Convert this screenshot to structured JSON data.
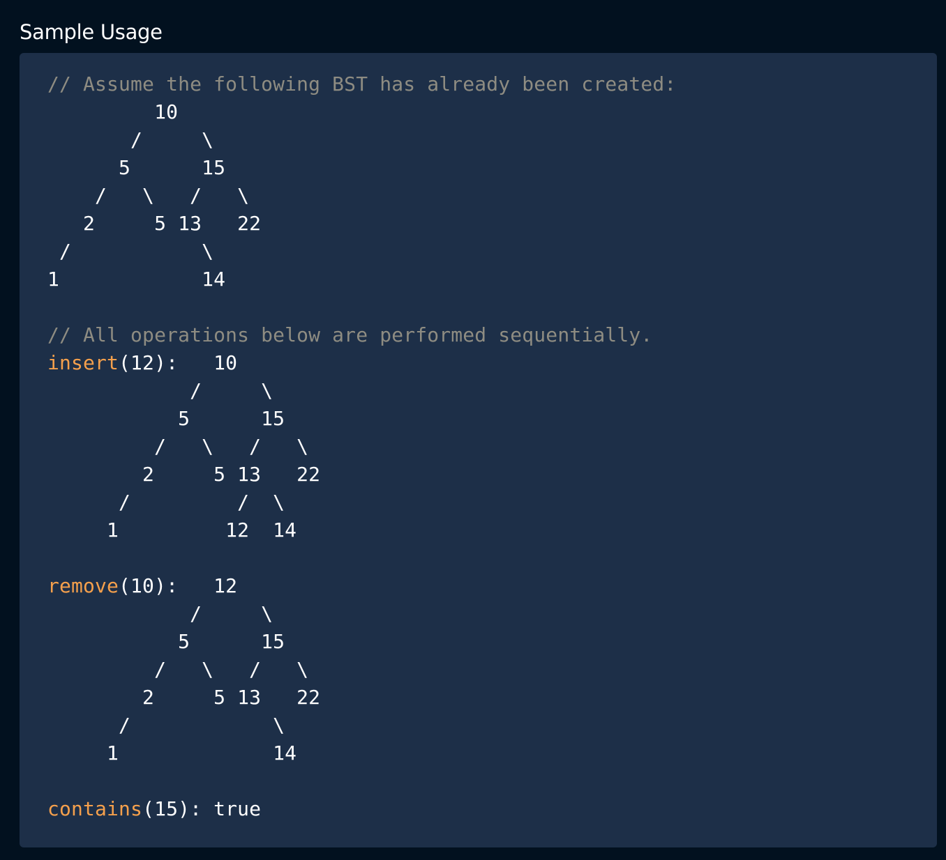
{
  "section": {
    "title": "Sample Usage"
  },
  "code": {
    "lines": [
      {
        "type": "comment",
        "text": "// Assume the following BST has already been created:"
      },
      {
        "type": "plain",
        "text": "         10"
      },
      {
        "type": "plain",
        "text": "       /     \\"
      },
      {
        "type": "plain",
        "text": "      5      15"
      },
      {
        "type": "plain",
        "text": "    /   \\   /   \\"
      },
      {
        "type": "plain",
        "text": "   2     5 13   22"
      },
      {
        "type": "plain",
        "text": " /           \\"
      },
      {
        "type": "plain",
        "text": "1            14"
      },
      {
        "type": "plain",
        "text": ""
      },
      {
        "type": "comment",
        "text": "// All operations below are performed sequentially."
      },
      {
        "type": "call",
        "fn": "insert",
        "rest": "(12):   10"
      },
      {
        "type": "plain",
        "text": "            /     \\"
      },
      {
        "type": "plain",
        "text": "           5      15"
      },
      {
        "type": "plain",
        "text": "         /   \\   /   \\"
      },
      {
        "type": "plain",
        "text": "        2     5 13   22"
      },
      {
        "type": "plain",
        "text": "      /         /  \\"
      },
      {
        "type": "plain",
        "text": "     1         12  14"
      },
      {
        "type": "plain",
        "text": ""
      },
      {
        "type": "call",
        "fn": "remove",
        "rest": "(10):   12"
      },
      {
        "type": "plain",
        "text": "            /     \\"
      },
      {
        "type": "plain",
        "text": "           5      15"
      },
      {
        "type": "plain",
        "text": "         /   \\   /   \\"
      },
      {
        "type": "plain",
        "text": "        2     5 13   22"
      },
      {
        "type": "plain",
        "text": "      /            \\"
      },
      {
        "type": "plain",
        "text": "     1             14"
      },
      {
        "type": "plain",
        "text": ""
      },
      {
        "type": "call",
        "fn": "contains",
        "rest": "(15): true"
      }
    ]
  },
  "colors": {
    "background": "#02111f",
    "panel": "#1d2f48",
    "comment": "#8e8c82",
    "function": "#f5a04c",
    "text": "#ffffff"
  }
}
